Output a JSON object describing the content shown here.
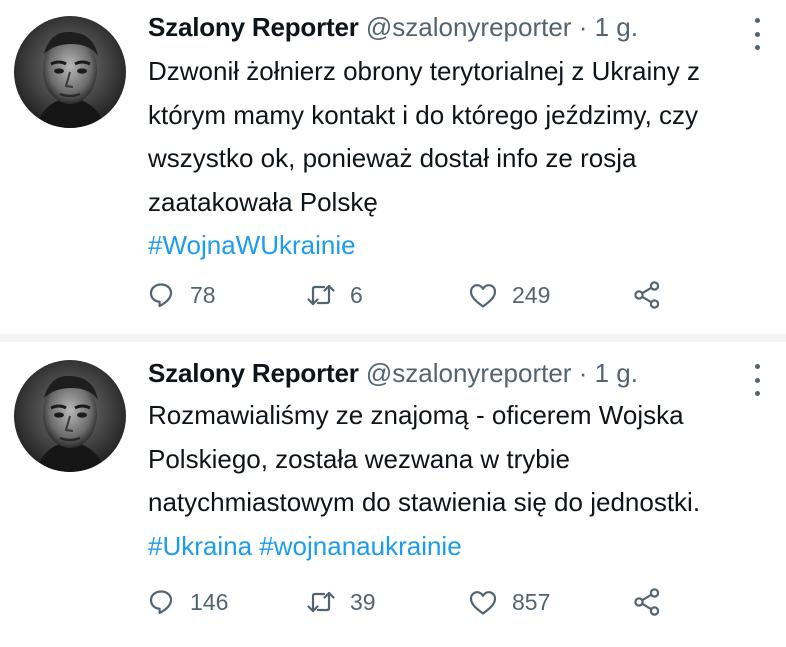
{
  "tweets": [
    {
      "name": "Szalony Reporter",
      "handle": "@szalonyreporter",
      "sep": " · ",
      "time": "1 g.",
      "text": "Dzwonił żołnierz obrony terytorialnej z Ukrainy z którym mamy kontakt i do którego jeździmy, czy wszystko ok, ponieważ dostał info ze rosja zaatakowała Polskę",
      "hashtags": [
        "#WojnaWUkrainie"
      ],
      "replies": "78",
      "retweets": "6",
      "likes": "249"
    },
    {
      "name": "Szalony Reporter",
      "handle": "@szalonyreporter",
      "sep": " · ",
      "time": "1 g.",
      "text": "Rozmawialiśmy ze znajomą - oficerem Wojska Polskiego, została wezwana w trybie natychmiastowym do stawienia się do jednostki.",
      "hashtags": [
        "#Ukraina",
        "#wojnanaukrainie"
      ],
      "replies": "146",
      "retweets": "39",
      "likes": "857"
    }
  ],
  "icons": {
    "reply": "reply-icon",
    "retweet": "retweet-icon",
    "like": "heart-icon",
    "share": "share-icon",
    "more": "more-options-icon"
  },
  "colors": {
    "text": "#0f1419",
    "secondary": "#536471",
    "link": "#1d9bf0",
    "divider": "#f3f4f5"
  }
}
